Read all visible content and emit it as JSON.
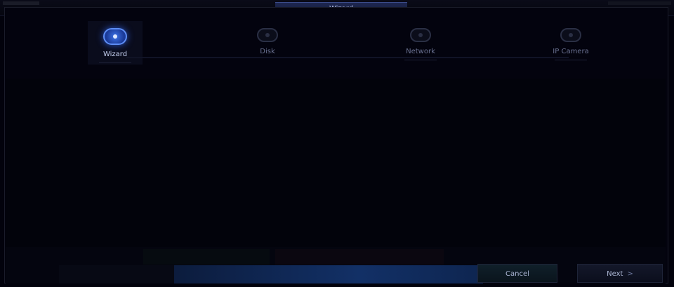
{
  "window": {
    "title": "Wizard"
  },
  "steps": [
    {
      "label": "Wizard",
      "icon": "gear-icon",
      "active": true
    },
    {
      "label": "Disk",
      "icon": "disk-icon",
      "active": false
    },
    {
      "label": "Network",
      "icon": "network-icon",
      "active": false
    },
    {
      "label": "IP Camera",
      "icon": "camera-icon",
      "active": false
    }
  ],
  "footer": {
    "cancel_label": "Cancel",
    "next_label": "Next",
    "next_arrow": ">"
  },
  "colors": {
    "background": "#02020c",
    "active_step": "#3e73e8",
    "title_tab": "#1e2750"
  }
}
